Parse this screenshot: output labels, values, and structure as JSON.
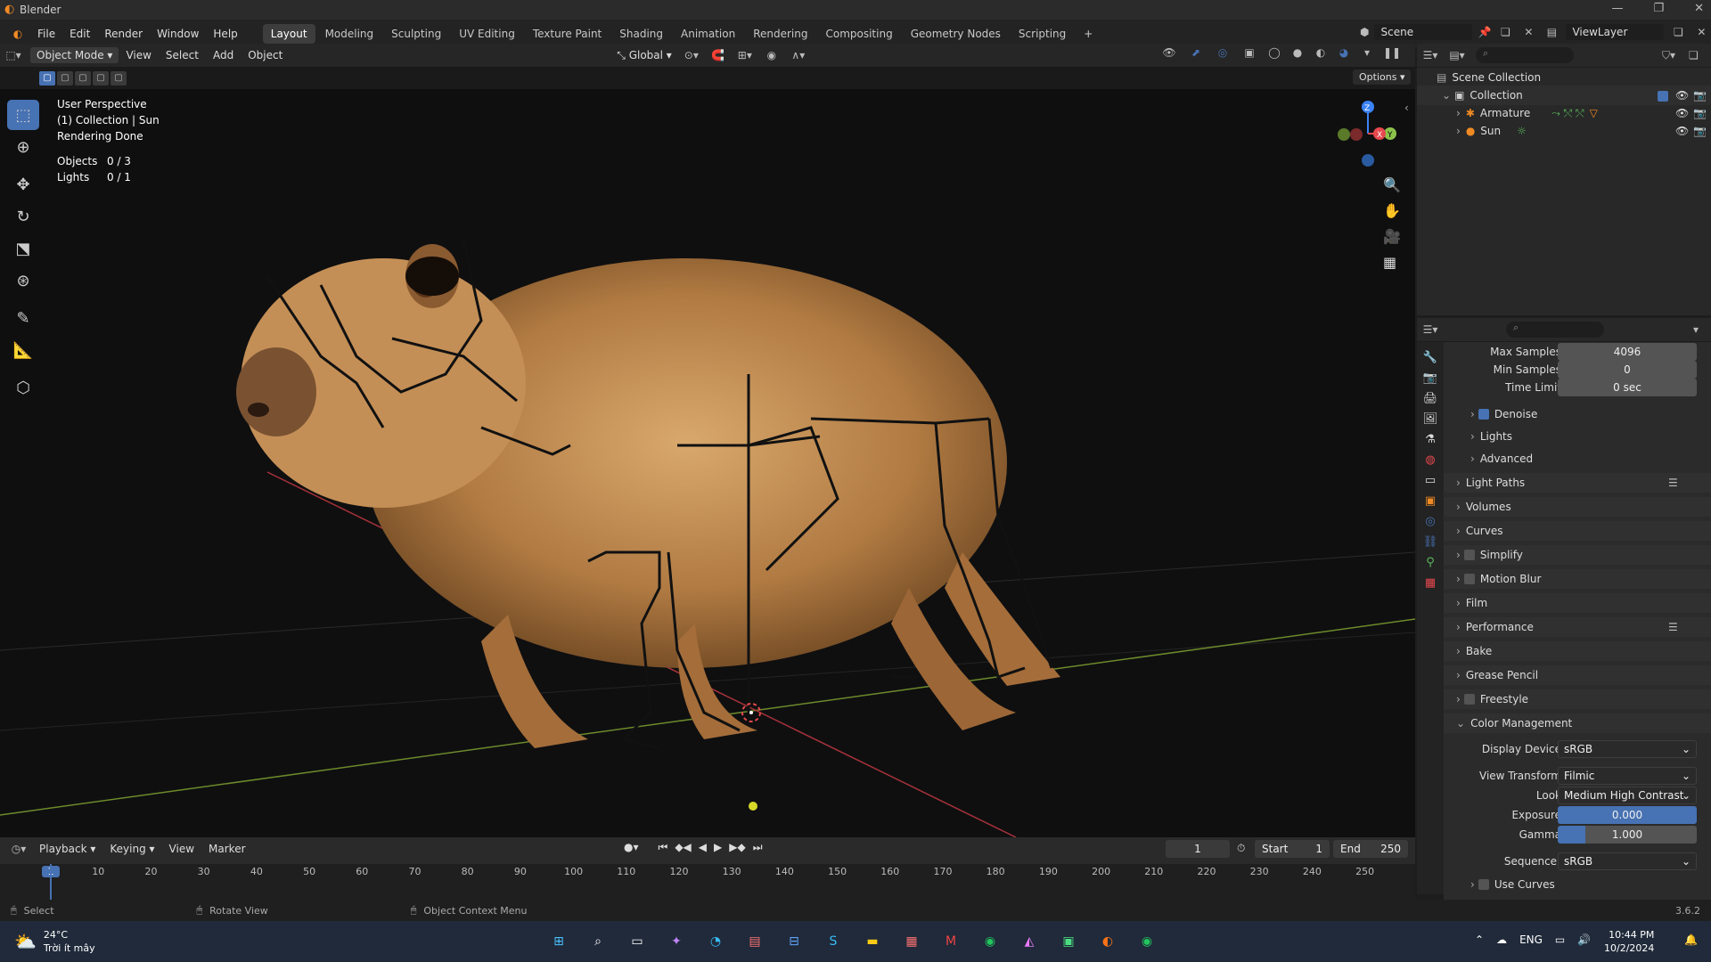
{
  "app": {
    "title": "Blender",
    "version": "3.6.2"
  },
  "menu": {
    "items": [
      "File",
      "Edit",
      "Render",
      "Window",
      "Help"
    ]
  },
  "workspaces": [
    "Layout",
    "Modeling",
    "Sculpting",
    "UV Editing",
    "Texture Paint",
    "Shading",
    "Animation",
    "Rendering",
    "Compositing",
    "Geometry Nodes",
    "Scripting",
    "+"
  ],
  "scene": {
    "label": "Scene",
    "viewlayer": "ViewLayer"
  },
  "viewport_header": {
    "mode": "Object Mode",
    "menus": [
      "View",
      "Select",
      "Add",
      "Object"
    ],
    "orientation": "Global",
    "options": "Options"
  },
  "viewport_info": {
    "perspective": "User Perspective",
    "collection": "(1) Collection | Sun",
    "status": "Rendering Done",
    "objects_label": "Objects",
    "objects_value": "0 / 3",
    "lights_label": "Lights",
    "lights_value": "0 / 1"
  },
  "gizmo": {
    "x": "X",
    "y": "Y",
    "z": "Z"
  },
  "outliner": {
    "root": "Scene Collection",
    "collection": "Collection",
    "items": [
      "Armature",
      "Sun"
    ]
  },
  "properties": {
    "max_samples_label": "Max Samples",
    "max_samples": "4096",
    "min_samples_label": "Min Samples",
    "min_samples": "0",
    "time_limit_label": "Time Limit",
    "time_limit": "0 sec",
    "denoise": "Denoise",
    "lights": "Lights",
    "advanced": "Advanced",
    "panels": [
      "Light Paths",
      "Volumes",
      "Curves",
      "Simplify",
      "Motion Blur",
      "Film",
      "Performance",
      "Bake",
      "Grease Pencil",
      "Freestyle"
    ],
    "color_management": "Color Management",
    "display_device_label": "Display Device",
    "display_device": "sRGB",
    "view_transform_label": "View Transform",
    "view_transform": "Filmic",
    "look_label": "Look",
    "look": "Medium High Contrast",
    "exposure_label": "Exposure",
    "exposure": "0.000",
    "gamma_label": "Gamma",
    "gamma": "1.000",
    "sequencer_label": "Sequencer",
    "sequencer": "sRGB",
    "use_curves": "Use Curves"
  },
  "timeline": {
    "menus": [
      "Playback",
      "Keying",
      "View",
      "Marker"
    ],
    "current_frame": "1",
    "start_label": "Start",
    "start": "1",
    "end_label": "End",
    "end": "250",
    "ticks": [
      "1",
      "10",
      "20",
      "30",
      "40",
      "50",
      "60",
      "70",
      "80",
      "90",
      "100",
      "110",
      "120",
      "130",
      "140",
      "150",
      "160",
      "170",
      "180",
      "190",
      "200",
      "210",
      "220",
      "230",
      "240",
      "250"
    ]
  },
  "statusbar": {
    "select": "Select",
    "rotate": "Rotate View",
    "context": "Object Context Menu"
  },
  "taskbar": {
    "temp": "24°C",
    "weather": "Trời ít mây",
    "lang": "ENG",
    "time": "10:44 PM",
    "date": "10/2/2024",
    "icons": [
      "windows-start-icon",
      "search-icon",
      "taskview-icon",
      "copilot-icon",
      "edge-icon",
      "app-icon",
      "store-icon",
      "skype-icon",
      "explorer-icon",
      "app2-icon",
      "app3-icon",
      "chrome-icon",
      "affinity-icon",
      "app4-icon",
      "blender-icon",
      "chrome2-icon"
    ]
  },
  "colors": {
    "accent": "#4772b3",
    "x_axis": "#e5484d",
    "y_axis": "#8cc34a",
    "z_axis": "#3b82f6"
  }
}
